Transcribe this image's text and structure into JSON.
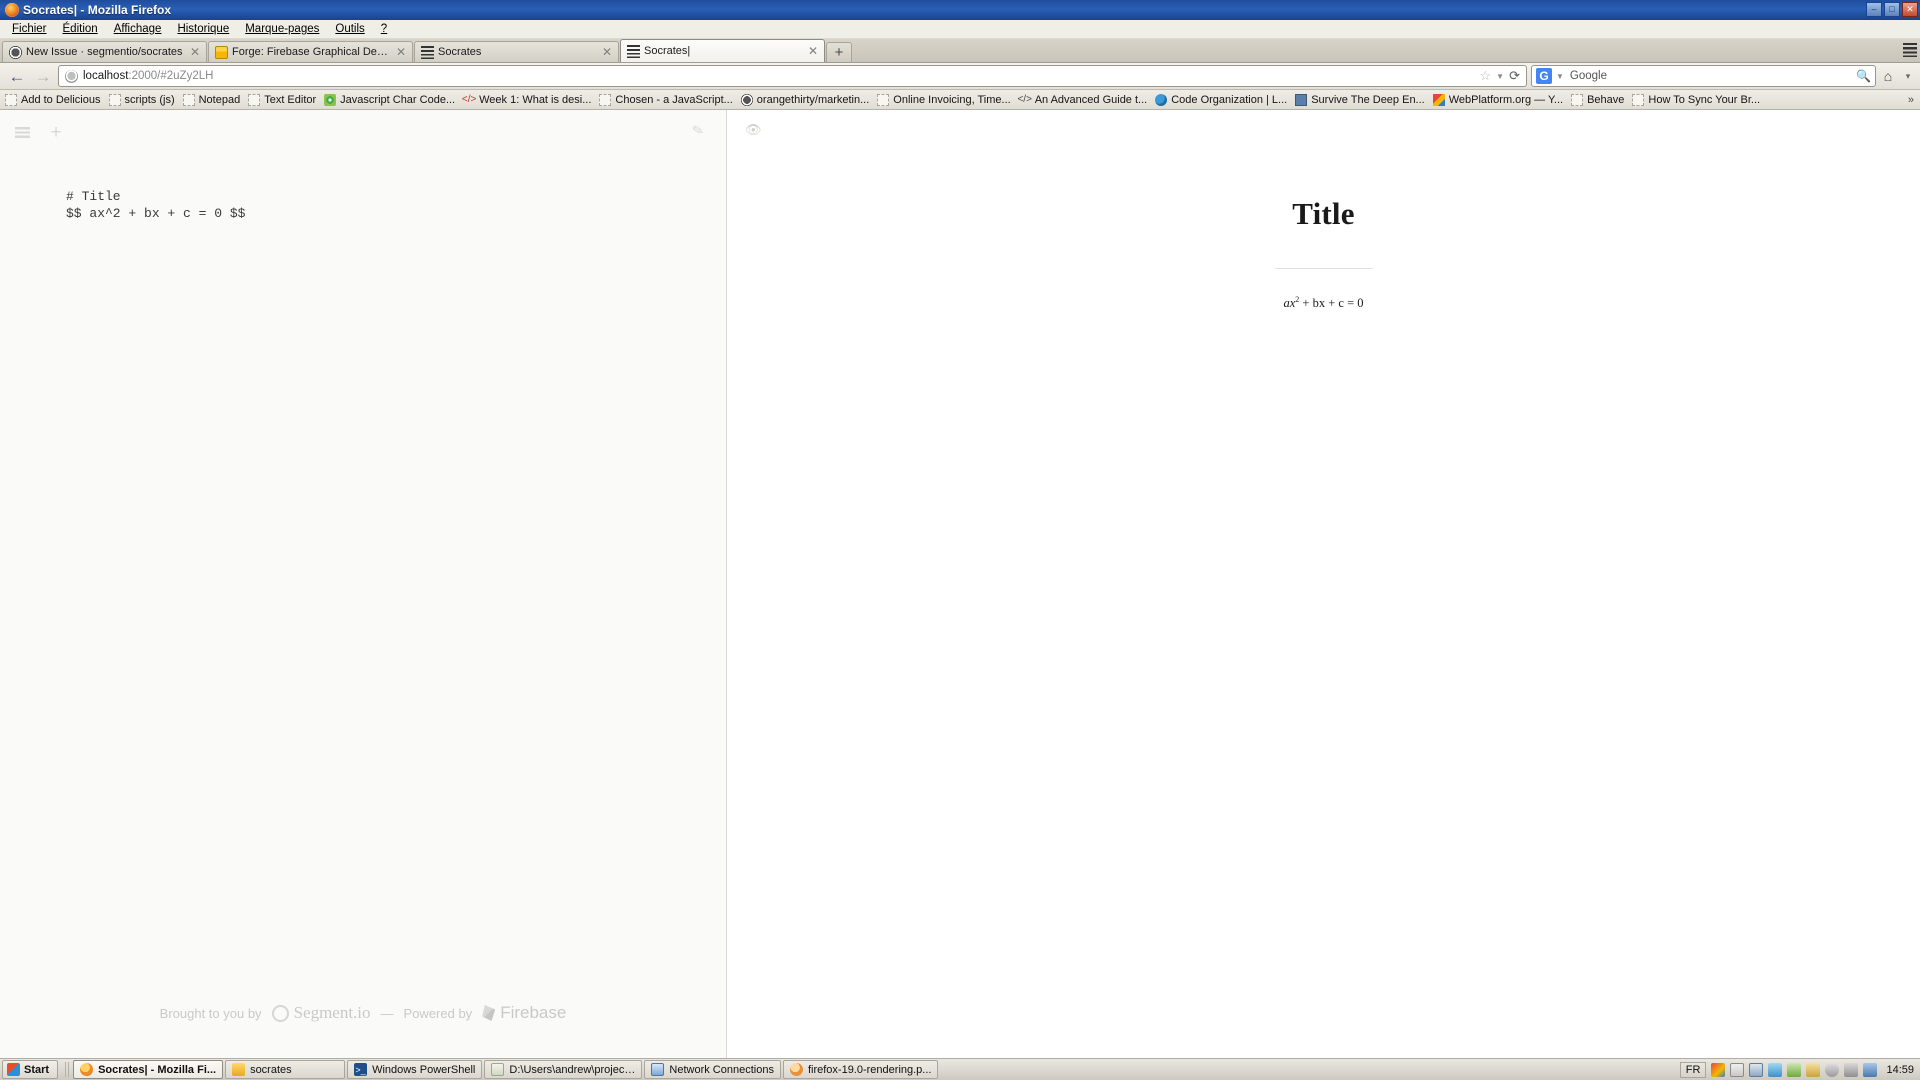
{
  "window": {
    "title": "Socrates| - Mozilla Firefox",
    "icon": "firefox-icon",
    "minimize": "‒",
    "maximize": "□",
    "close": "✕"
  },
  "menubar": [
    {
      "label": "Fichier"
    },
    {
      "label": "Édition"
    },
    {
      "label": "Affichage"
    },
    {
      "label": "Historique"
    },
    {
      "label": "Marque-pages"
    },
    {
      "label": "Outils"
    },
    {
      "label": "?"
    }
  ],
  "tabs": [
    {
      "label": "New Issue · segmentio/socrates",
      "icon": "github-icon",
      "active": false,
      "close": "✕"
    },
    {
      "label": "Forge: Firebase Graphical Debugger",
      "icon": "firebase-icon",
      "active": false,
      "close": "✕"
    },
    {
      "label": "Socrates",
      "icon": "socrates-icon",
      "active": false,
      "close": "✕"
    },
    {
      "label": "Socrates|",
      "icon": "socrates-icon",
      "active": true,
      "close": "✕"
    }
  ],
  "newtab_label": "+",
  "navbar": {
    "back_icon": "←",
    "forward_icon": "→",
    "url_host": "localhost",
    "url_rest": ":2000/#2uZy2LH",
    "star_icon": "☆",
    "caret_icon": "▼",
    "reload_icon": "⟳",
    "search_engine": "G",
    "search_placeholder": "Google",
    "search_icon": "🔍",
    "home_icon": "⌂",
    "menu_caret": "▾"
  },
  "bookmarks": [
    {
      "label": "Add to Delicious",
      "icon": "blank-icon"
    },
    {
      "label": "scripts (js)",
      "icon": "blank-icon"
    },
    {
      "label": "Notepad",
      "icon": "blank-icon"
    },
    {
      "label": "Text Editor",
      "icon": "blank-icon"
    },
    {
      "label": "Javascript Char Code...",
      "icon": "spiral-green-icon"
    },
    {
      "label": "Week 1: What is desi...",
      "icon": "code-tag-icon"
    },
    {
      "label": "Chosen - a JavaScript...",
      "icon": "blank-icon"
    },
    {
      "label": "orangethirty/marketin...",
      "icon": "dark-circle-icon"
    },
    {
      "label": "Online Invoicing, Time...",
      "icon": "blank-icon"
    },
    {
      "label": "An Advanced Guide t...",
      "icon": "code-tag-icon"
    },
    {
      "label": "Code Organization | L...",
      "icon": "moon-blue-icon"
    },
    {
      "label": "Survive The Deep En...",
      "icon": "building-icon"
    },
    {
      "label": "WebPlatform.org — Y...",
      "icon": "webplatform-icon"
    },
    {
      "label": "Behave",
      "icon": "blank-icon"
    },
    {
      "label": "How To Sync Your Br...",
      "icon": "blank-icon"
    }
  ],
  "bookmarks_overflow": "»",
  "editor": {
    "menu_icon": "hamburger-icon",
    "add_icon": "plus-icon",
    "edit_icon": "pencil-icon",
    "source": "# Title\n$$ ax^2 + bx + c = 0 $$",
    "footer": {
      "brought_text": "Brought to you by",
      "segment_name": "Segment.io",
      "dash": "—",
      "powered_text": "Powered by",
      "firebase_name": "Firebase"
    }
  },
  "preview": {
    "eye_icon": "👁",
    "title": "Title",
    "math_a": "ax",
    "math_exp": "2",
    "math_rest": " + bx + c = 0"
  },
  "taskbar": {
    "start_label": "Start",
    "items": [
      {
        "label": "Socrates| - Mozilla Fi...",
        "icon": "firefox-icon",
        "active": true
      },
      {
        "label": "socrates",
        "icon": "folder-icon",
        "active": false
      },
      {
        "label": "Windows PowerShell",
        "icon": "powershell-icon",
        "active": false
      },
      {
        "label": "D:\\Users\\andrew\\project...",
        "icon": "editor-icon",
        "active": false
      },
      {
        "label": "Network Connections",
        "icon": "network-icon",
        "active": false
      },
      {
        "label": "firefox-19.0-rendering.p...",
        "icon": "document-icon",
        "active": false
      }
    ],
    "tray": {
      "language": "FR",
      "icons": [
        "paint-icon",
        "mail-icon",
        "monitor-icon",
        "shield-icon",
        "sync-icon",
        "key-icon",
        "power-icon",
        "volume-icon",
        "flag-icon"
      ],
      "clock": "14:59"
    }
  },
  "colors": {
    "titlebar_blue": "#1f4d9e",
    "accent_google": "#4285f4",
    "editor_bg": "#fafaf9",
    "preview_bg": "#ffffff"
  }
}
